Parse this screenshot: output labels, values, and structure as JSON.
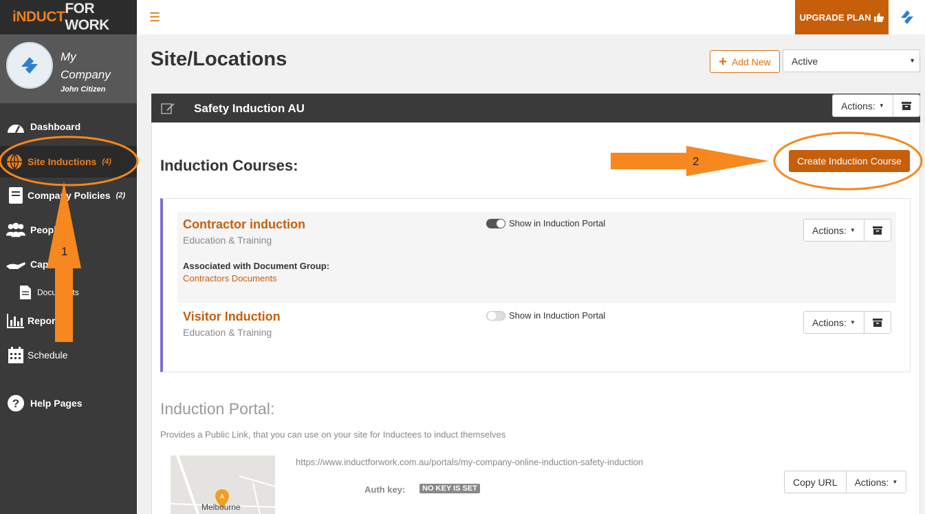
{
  "brand": {
    "part1": "iNDUCT",
    "part2": "FOR WORK"
  },
  "profile": {
    "company": "My Company",
    "user": "John Citizen"
  },
  "sidebar": {
    "items": [
      {
        "label": "Dashboard",
        "count": ""
      },
      {
        "label": "Site Inductions",
        "count": "(4)"
      },
      {
        "label": "Company Policies",
        "count": "(2)"
      },
      {
        "label": "People",
        "count": ""
      },
      {
        "label": "Capture",
        "count": ""
      },
      {
        "label": "Documents",
        "count": ""
      },
      {
        "label": "Reports",
        "count": ""
      },
      {
        "label": "Schedule",
        "count": ""
      },
      {
        "label": "Help Pages",
        "count": ""
      }
    ]
  },
  "topbar": {
    "upgrade_label": "UPGRADE PLAN"
  },
  "header": {
    "title": "Site/Locations",
    "add_new": "Add New",
    "status": "Active"
  },
  "site": {
    "name": "Safety Induction AU",
    "actions": "Actions:"
  },
  "induction": {
    "heading": "Induction Courses:",
    "create_button": "Create Induction Course",
    "courses": [
      {
        "name": "Contractor induction",
        "category": "Education & Training",
        "portal_label": "Show in Induction Portal",
        "portal_on": true,
        "assoc_label": "Associated with Document Group:",
        "assoc_value": "Contractors Documents",
        "actions": "Actions:"
      },
      {
        "name": "Visitor Induction",
        "category": "Education & Training",
        "portal_label": "Show in Induction Portal",
        "portal_on": false,
        "actions": "Actions:"
      }
    ]
  },
  "portal": {
    "heading": "Induction Portal:",
    "description": "Provides a Public Link, that you can use on your site for Inductees to induct themselves",
    "url": "https://www.inductforwork.com.au/portals/my-company-online-induction-safety-induction",
    "auth_label": "Auth key:",
    "auth_value": "NO KEY IS SET",
    "copy_url": "Copy URL",
    "actions": "Actions:",
    "map_label": "Melbourne"
  },
  "annotations": {
    "step1": "1",
    "step2": "2"
  },
  "colors": {
    "accent": "#c75e0a",
    "annotation": "#f7871f",
    "sidebar": "#3a3a3a"
  }
}
